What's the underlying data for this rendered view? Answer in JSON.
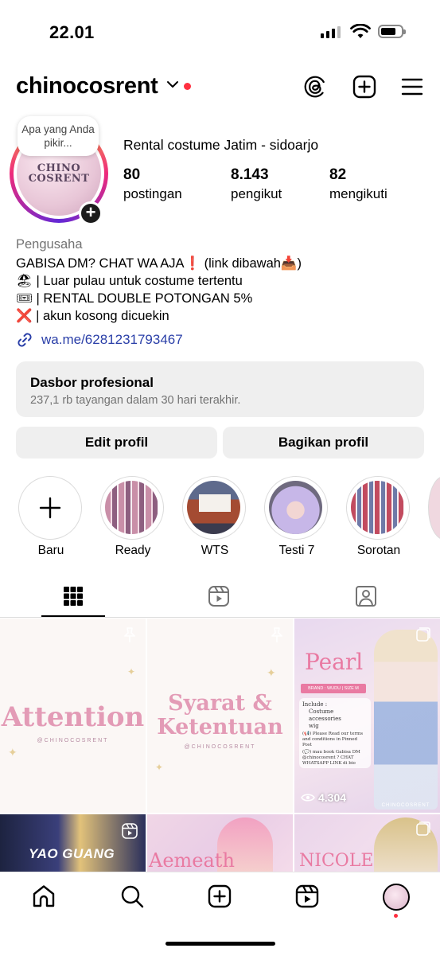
{
  "status_bar": {
    "time": "22.01"
  },
  "header": {
    "username": "chinocosrent"
  },
  "profile": {
    "note": "Apa yang Anda pikir...",
    "avatar_text": "CHINO COSRENT",
    "display_name": "Rental costume Jatim - sidoarjo",
    "stats": [
      {
        "value": "80",
        "label": "postingan"
      },
      {
        "value": "8.143",
        "label": "pengikut"
      },
      {
        "value": "82",
        "label": "mengikuti"
      }
    ],
    "category": "Pengusaha",
    "bio": [
      "GABISA DM? CHAT WA AJA❗️ (link dibawah📥)",
      "🏖 | Luar pulau untuk costume tertentu",
      "🎟 | RENTAL DOUBLE POTONGAN 5%",
      "❌ | akun kosong dicuekin"
    ],
    "link": "wa.me/6281231793467"
  },
  "dashboard": {
    "title": "Dasbor profesional",
    "subtitle": "237,1 rb tayangan dalam 30 hari terakhir."
  },
  "buttons": {
    "edit": "Edit profil",
    "share": "Bagikan profil"
  },
  "highlights": [
    {
      "label": "Baru"
    },
    {
      "label": "Ready"
    },
    {
      "label": "WTS"
    },
    {
      "label": "Testi 7"
    },
    {
      "label": "Sorotan"
    }
  ],
  "grid": {
    "tile1_text": "Attention",
    "tile1_handle": "@CHINOCOSRENT",
    "tile2_line1": "Syarat &",
    "tile2_line2": "Ketentuan",
    "tile2_handle": "@CHINOCOSRENT",
    "tile3_title": "Pearl",
    "tile3_brand": "BRAND : WUDU | SIZE M",
    "tile3_include_label": "Include :",
    "tile3_items": [
      "Costume",
      "accessories",
      "wig"
    ],
    "tile3_note1": "(📢) Please Read our terms and conditions in Pinned Post",
    "tile3_note2": "(💬) mau book Gabisa DM @chinocosrent ? CHAT WHATSAPP LINK di bio",
    "tile3_views": "4.304",
    "tile3_handle": "CHINOCOSRENT",
    "tile4_text": "YAO GUANG",
    "tile5_text": "Aemeath",
    "tile6_text": "NICOLE"
  },
  "colors": {
    "link": "#2a3fa8",
    "notification": "#ff3040",
    "tile_pink": "#e39bb6"
  }
}
